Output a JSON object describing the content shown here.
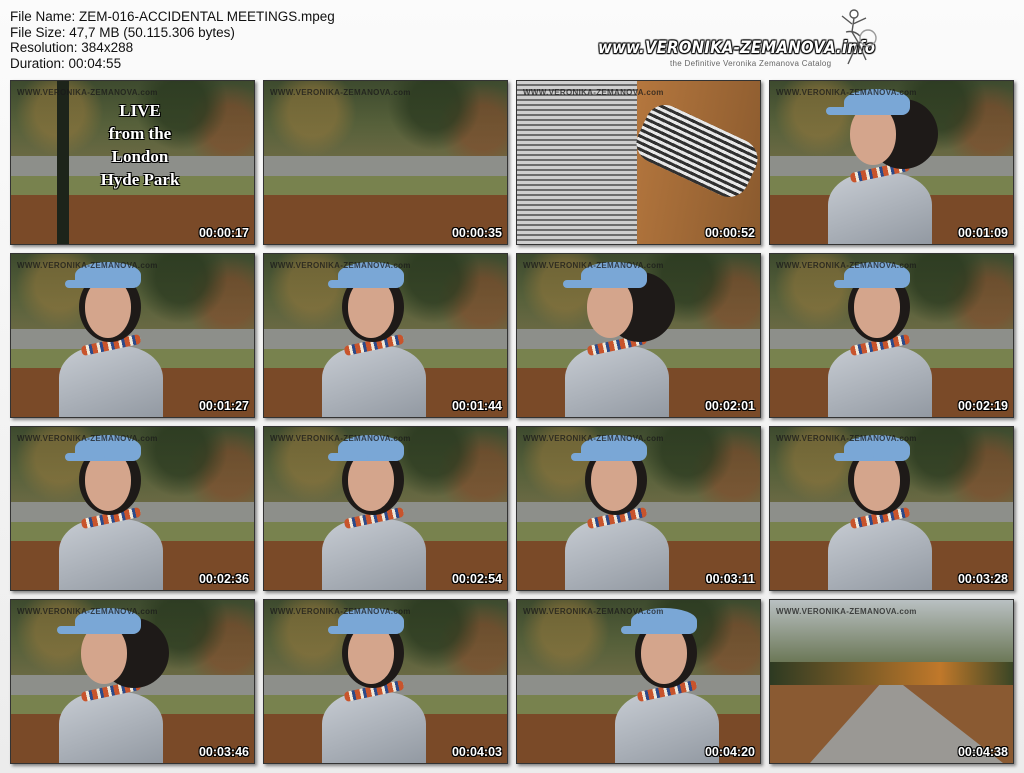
{
  "file_info": {
    "name": "File Name: ZEM-016-ACCIDENTAL MEETINGS.mpeg",
    "size": "File Size: 47,7 MB (50.115.306 bytes)",
    "resolution": "Resolution: 384x288",
    "duration": "Duration: 00:04:55"
  },
  "logo": {
    "site": "www.VERONIKA-ZEMANOVA.info",
    "tagline": "the Definitive Veronika Zemanova Catalog"
  },
  "watermark": "WWW.VERONIKA-ZEMANOVA.com",
  "overlay_text": [
    "LIVE",
    "from the",
    "London",
    "Hyde Park"
  ],
  "thumbnails": [
    {
      "time": "00:00:17",
      "scene": "title"
    },
    {
      "time": "00:00:35",
      "scene": "park-path"
    },
    {
      "time": "00:00:52",
      "scene": "blur"
    },
    {
      "time": "00:01:09",
      "scene": "profile"
    },
    {
      "time": "00:01:27",
      "scene": "front"
    },
    {
      "time": "00:01:44",
      "scene": "front"
    },
    {
      "time": "00:02:01",
      "scene": "profile"
    },
    {
      "time": "00:02:19",
      "scene": "front"
    },
    {
      "time": "00:02:36",
      "scene": "front"
    },
    {
      "time": "00:02:54",
      "scene": "front"
    },
    {
      "time": "00:03:11",
      "scene": "front"
    },
    {
      "time": "00:03:28",
      "scene": "front"
    },
    {
      "time": "00:03:46",
      "scene": "profile"
    },
    {
      "time": "00:04:03",
      "scene": "front"
    },
    {
      "time": "00:04:20",
      "scene": "walking"
    },
    {
      "time": "00:04:38",
      "scene": "avenue"
    }
  ]
}
